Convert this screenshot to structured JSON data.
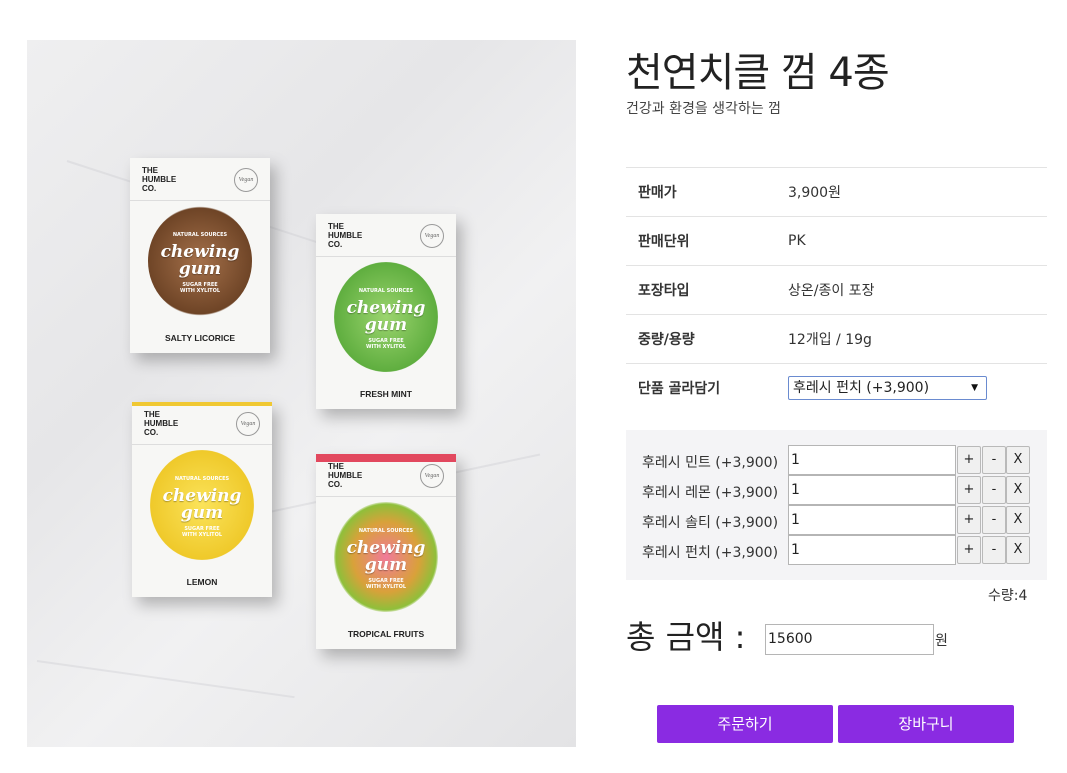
{
  "product": {
    "title": "천연치클 껌 4종",
    "subtitle": "건강과 환경을 생각하는 껌",
    "image_packs": [
      {
        "brand_line1": "THE",
        "brand_line2": "HUMBLE",
        "brand_line3": "CO.",
        "vegan": "Vegan",
        "natural": "NATURAL SOURCES",
        "name_line1": "chewing",
        "name_line2": "gum",
        "sugar": "SUGAR FREE",
        "xylitol": "WITH XYLITOL",
        "flavor": "SALTY LICORICE",
        "color": "#7a4a2a"
      },
      {
        "brand_line1": "THE",
        "brand_line2": "HUMBLE",
        "brand_line3": "CO.",
        "vegan": "Vegan",
        "natural": "NATURAL SOURCES",
        "name_line1": "chewing",
        "name_line2": "gum",
        "sugar": "SUGAR FREE",
        "xylitol": "WITH XYLITOL",
        "flavor": "FRESH MINT",
        "color": "#7cc35a"
      },
      {
        "brand_line1": "THE",
        "brand_line2": "HUMBLE",
        "brand_line3": "CO.",
        "vegan": "Vegan",
        "natural": "NATURAL SOURCES",
        "name_line1": "chewing",
        "name_line2": "gum",
        "sugar": "SUGAR FREE",
        "xylitol": "WITH XYLITOL",
        "flavor": "LEMON",
        "color": "#f3d13a"
      },
      {
        "brand_line1": "THE",
        "brand_line2": "HUMBLE",
        "brand_line3": "CO.",
        "vegan": "Vegan",
        "natural": "NATURAL SOURCES",
        "name_line1": "chewing",
        "name_line2": "gum",
        "sugar": "SUGAR FREE",
        "xylitol": "WITH XYLITOL",
        "flavor": "TROPICAL FRUITS",
        "color": "#e2485e"
      }
    ]
  },
  "info": [
    {
      "label": "판매가",
      "value": "3,900원"
    },
    {
      "label": "판매단위",
      "value": "PK"
    },
    {
      "label": "포장타입",
      "value": "상온/종이 포장"
    },
    {
      "label": "중량/용량",
      "value": "12개입 / 19g"
    },
    {
      "label": "단품 골라담기",
      "value": "후레시 펀치 (+3,900)"
    }
  ],
  "select_arrow": "▼",
  "selected_options": [
    {
      "label": "후레시 민트 (+3,900)",
      "qty": "1",
      "plus": "+",
      "minus": "-",
      "remove": "X"
    },
    {
      "label": "후레시 레몬 (+3,900)",
      "qty": "1",
      "plus": "+",
      "minus": "-",
      "remove": "X"
    },
    {
      "label": "후레시 솔티 (+3,900)",
      "qty": "1",
      "plus": "+",
      "minus": "-",
      "remove": "X"
    },
    {
      "label": "후레시 펀치 (+3,900)",
      "qty": "1",
      "plus": "+",
      "minus": "-",
      "remove": "X"
    }
  ],
  "quantity_text": "수량:4",
  "total": {
    "label": "총 금액 :",
    "value": "15600",
    "unit": "원"
  },
  "buttons": {
    "order": "주문하기",
    "cart": "장바구니"
  },
  "colors": {
    "accent": "#8a2be2",
    "options_bg": "#f4f4f6"
  }
}
